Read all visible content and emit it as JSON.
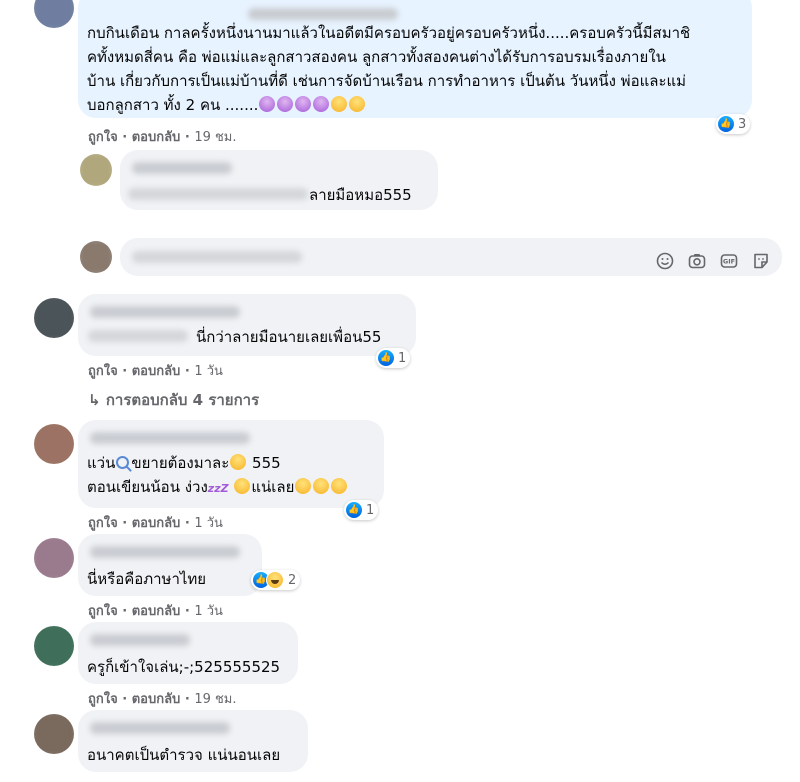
{
  "comments": [
    {
      "text_lines": [
        "กบกินเดือน กาลครั้งหนึ่งนานมาแล้วในอดีตมีครอบครัวอยู่ครอบครัวหนึ่ง.....ครอบครัวนี้มีสมาชิ",
        "คทั้งหมดสี่คน คือ พ่อแม่และลูกสาวสองคน ลูกสาวทั้งสองคนต่างได้รับการอบรมเรื่องภายใน",
        "บ้าน เกี่ยวกับการเป็นแม่บ้านที่ดี เช่นการจัดบ้านเรือน การทำอาหาร เป็นต้น วันหนึ่ง พ่อและแม่",
        "บอกลูกสาว ทั้ง 2 คน ......."
      ],
      "like": "ถูกใจ",
      "reply": "ตอบกลับ",
      "time": "19 ชม.",
      "reactions": "3"
    },
    {
      "text": "ลายมือหมอ555"
    },
    {
      "text": "นี่กว่าลายมือนายเลยเพื่อน55",
      "like": "ถูกใจ",
      "reply": "ตอบกลับ",
      "time": "1 วัน",
      "reactions": "1",
      "replies_link": "การตอบกลับ 4 รายการ"
    },
    {
      "line1_a": "แว่น",
      "line1_b": "ขยายต้องมาละ",
      "line1_c": "555",
      "line2_a": "ตอนเขียนน้อน ง่วง",
      "line2_zzz": "zzZ",
      "line2_b": "แน่เลย",
      "like": "ถูกใจ",
      "reply": "ตอบกลับ",
      "time": "1 วัน",
      "reactions": "1"
    },
    {
      "text": "นี่หรือคือภาษาไทย",
      "like": "ถูกใจ",
      "reply": "ตอบกลับ",
      "time": "1 วัน",
      "reactions": "2"
    },
    {
      "text": "ครูก็เข้าใจเล่น;-;525555525",
      "like": "ถูกใจ",
      "reply": "ตอบกลับ",
      "time": "19 ชม."
    },
    {
      "text": "อนาคตเป็นตำรวจ แน่นอนเลย"
    }
  ],
  "icons": [
    "emoji-icon",
    "camera-icon",
    "gif-icon",
    "sticker-icon"
  ],
  "colors": {
    "like_blue": "#1877f2",
    "bubble": "#f0f2f5",
    "highlight": "#e7f3ff",
    "meta": "#65676b"
  }
}
